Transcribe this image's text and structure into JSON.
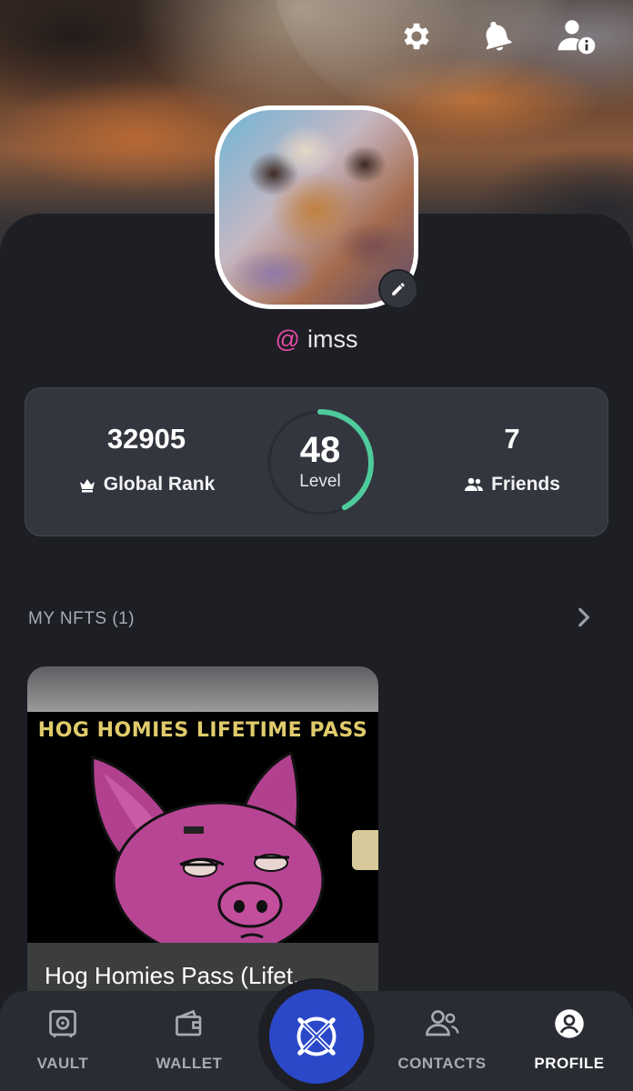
{
  "profile": {
    "username_prefix": "@",
    "username": "imss"
  },
  "stats": {
    "global_rank_value": "32905",
    "global_rank_label": "Global Rank",
    "level_value": "48",
    "level_label": "Level",
    "level_progress": 0.42,
    "friends_value": "7",
    "friends_label": "Friends"
  },
  "nfts": {
    "section_title": "MY NFTS (1)",
    "items": [
      {
        "banner_text": "Hog Homies Lifetime Pass",
        "caption": "Hog Homies Pass (Lifet..."
      }
    ]
  },
  "nav": {
    "items": [
      {
        "label": "VAULT",
        "icon": "vault-icon"
      },
      {
        "label": "WALLET",
        "icon": "wallet-icon"
      },
      {
        "label": "",
        "icon": "elrond-logo-icon"
      },
      {
        "label": "CONTACTS",
        "icon": "contacts-icon"
      },
      {
        "label": "PROFILE",
        "icon": "profile-icon"
      }
    ],
    "active": "PROFILE"
  },
  "colors": {
    "background": "#1d1f25",
    "card": "#33363f",
    "accent_at": "#e64aa5",
    "level_ring": "#4ecb9a",
    "center_button": "#2a48c8"
  }
}
